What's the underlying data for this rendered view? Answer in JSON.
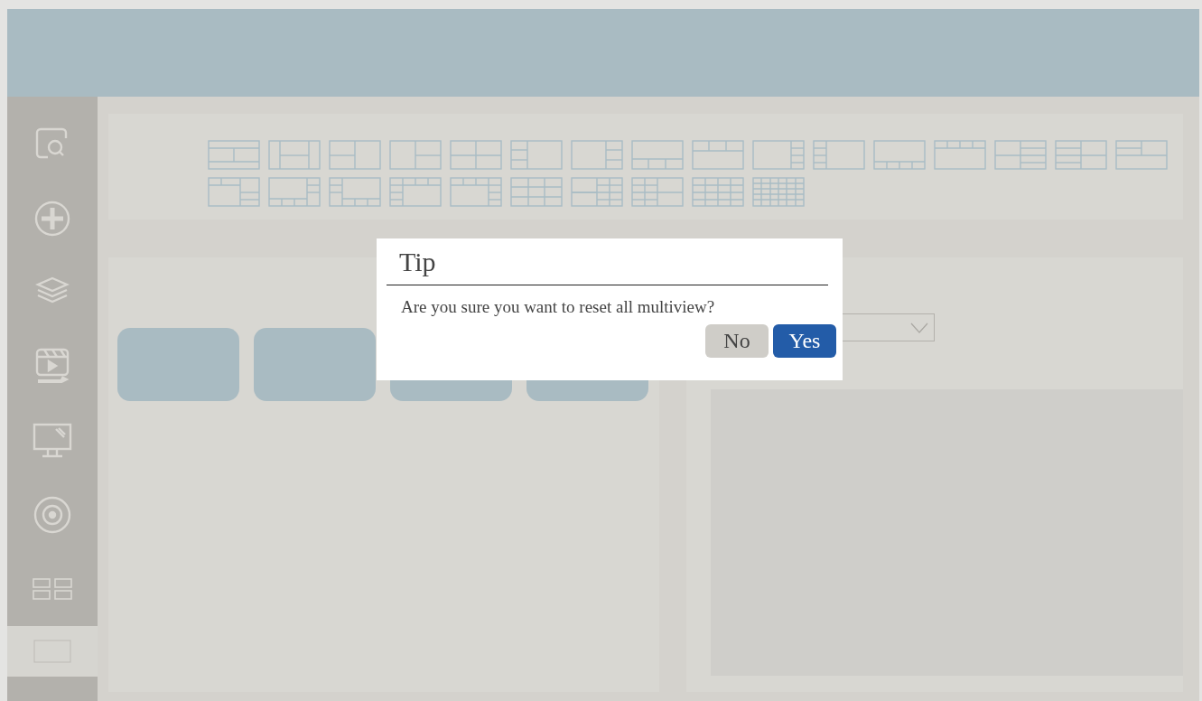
{
  "sidebar": {
    "items": [
      {
        "selected": false
      },
      {
        "selected": false
      },
      {
        "selected": false
      },
      {
        "selected": false
      },
      {
        "selected": false
      },
      {
        "selected": false
      },
      {
        "selected": false
      },
      {
        "selected": true
      }
    ]
  },
  "dialog": {
    "title": "Tip",
    "message": "Are you sure you want to reset all multiview?",
    "buttons": [
      {
        "label": "No",
        "kind": "secondary"
      },
      {
        "label": "Yes",
        "kind": "primary"
      }
    ]
  }
}
